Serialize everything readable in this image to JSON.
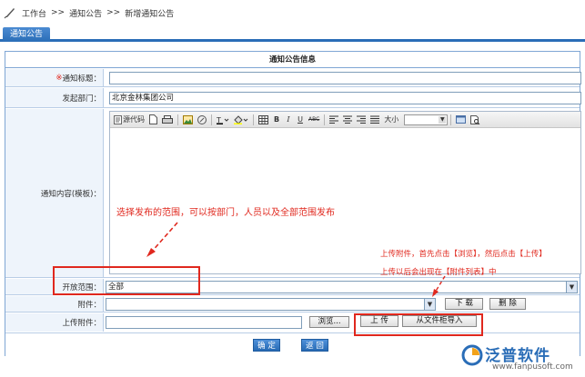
{
  "breadcrumb": {
    "items": [
      "工作台",
      "通知公告",
      "新增通知公告"
    ],
    "separator": ">>"
  },
  "tab": {
    "label": "通知公告"
  },
  "form": {
    "title": "通知公告信息",
    "fields": {
      "title": {
        "required_mark": "※",
        "label": "通知标题：",
        "value": ""
      },
      "department": {
        "label": "发起部门：",
        "value": "北京金林集团公司"
      },
      "content": {
        "label": "通知内容(模板)："
      },
      "scope": {
        "label": "开放范围：",
        "value": "全部"
      },
      "attachment": {
        "label": "附件：",
        "value": ""
      },
      "upload": {
        "label": "上传附件：",
        "value": ""
      }
    },
    "editor": {
      "toolbar": {
        "source_label": "源代码",
        "font_size_label": "大小",
        "bold": "B",
        "italic": "I",
        "underline": "U",
        "strike": "ABC"
      }
    },
    "buttons": {
      "download": "下 载",
      "delete": "删 除",
      "browse": "浏览...",
      "upload": "上 传",
      "import_from_cabinet": "从文件柜导入",
      "confirm": "确 定",
      "back": "返 回"
    }
  },
  "annotations": {
    "scope_hint": "选择发布的范围，可以按部门，人员以及全部范围发布",
    "upload_hint_line1": "上传附件，首先点击【浏览】，然后点击【上传】",
    "upload_hint_line2": "上传以后会出现在【附件列表】中"
  },
  "brand": {
    "name": "泛普软件",
    "url": "www.fanpusoft.com"
  },
  "colors": {
    "accent": "#2a6db7",
    "annotation": "#e0281e",
    "label_bg": "#eef4fb",
    "border": "#7fa6d4"
  },
  "icons": {
    "breadcrumb": "quill-pen-icon",
    "dropdown": "chevron-down-icon",
    "brand": "fanpu-logo-icon"
  }
}
